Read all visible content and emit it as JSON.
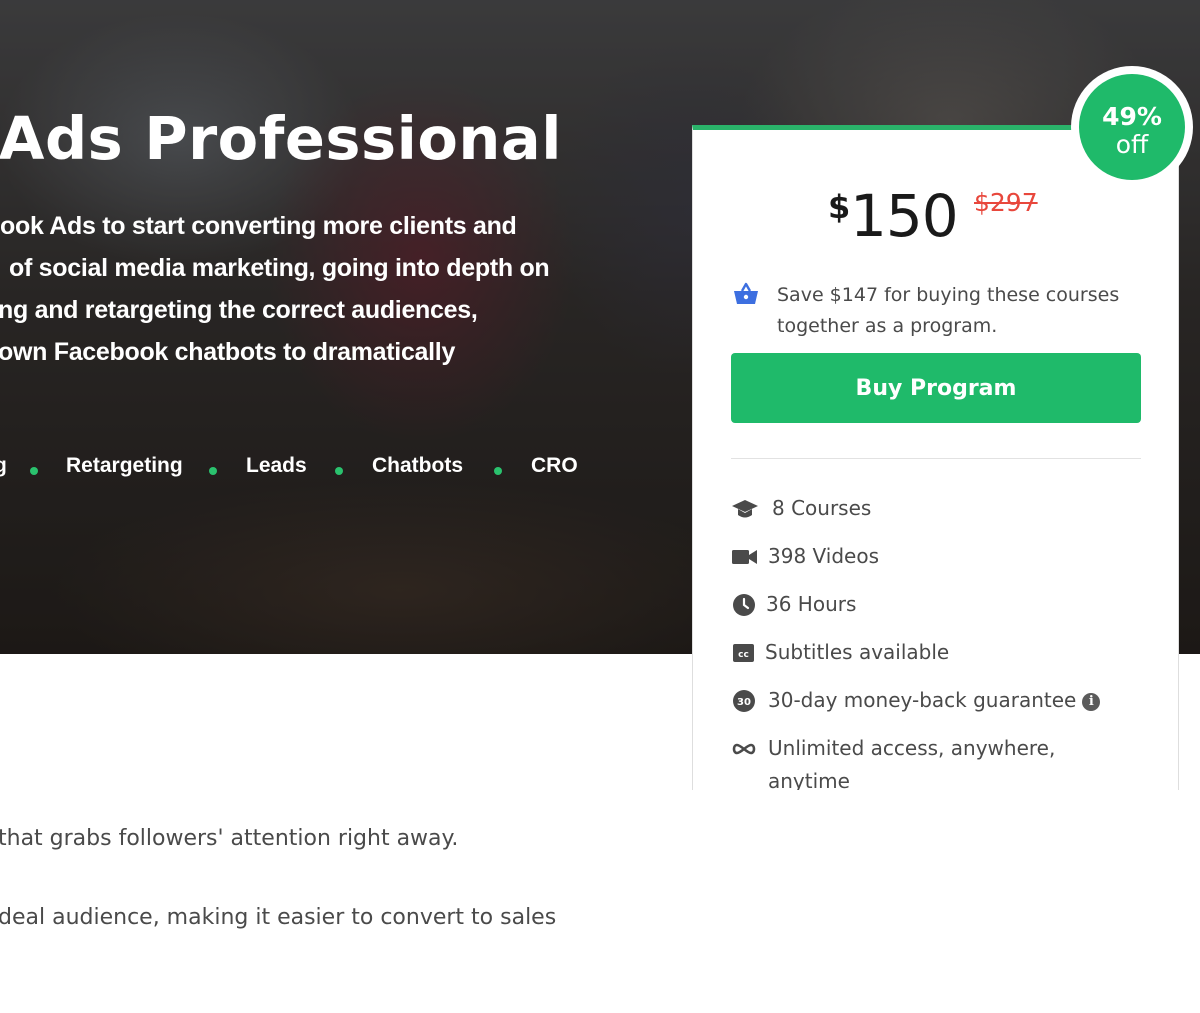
{
  "hero": {
    "title": "k Ads Professional",
    "description_lines": [
      "ook Ads to start converting more clients and",
      "of social media marketing, going into depth on",
      "ng and retargeting the correct audiences,",
      "own Facebook chatbots to dramatically"
    ],
    "tags": [
      "g",
      "Retargeting",
      "Leads",
      "Chatbots",
      "CRO"
    ]
  },
  "body": {
    "lines": [
      "that grabs followers' attention right away.",
      "deal audience, making it easier to convert to sales"
    ]
  },
  "card": {
    "badge": {
      "percent": "49%",
      "label": "off"
    },
    "price": {
      "currency": "$",
      "amount": "150",
      "original": "$297"
    },
    "save_text": "Save $147 for buying these courses together as a program.",
    "buy_label": "Buy Program",
    "features": [
      {
        "icon": "graduation-cap-icon",
        "text": "8 Courses"
      },
      {
        "icon": "video-camera-icon",
        "text": "398 Videos"
      },
      {
        "icon": "clock-icon",
        "text": "36 Hours"
      },
      {
        "icon": "closed-captions-icon",
        "text": "Subtitles available"
      },
      {
        "icon": "money-back-30-icon",
        "text": "30-day money-back guarantee",
        "icon_label": "30"
      },
      {
        "icon": "infinity-icon",
        "text": "Unlimited access, anywhere,",
        "text2": "anytime"
      }
    ],
    "colors": {
      "accent": "#1fba6a",
      "strike": "#e8473c",
      "basket": "#3d6fe0"
    }
  }
}
